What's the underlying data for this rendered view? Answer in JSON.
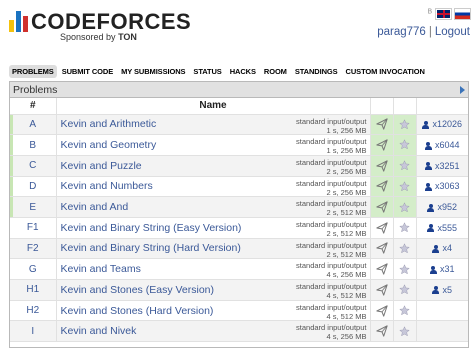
{
  "header": {
    "logo_text": "CODEFORCES",
    "sponsor_prefix": "Sponsored by",
    "sponsor_name": "TON",
    "username": "parag776",
    "separator": "|",
    "logout": "Logout"
  },
  "menu": [
    {
      "label": "PROBLEMS",
      "active": true
    },
    {
      "label": "SUBMIT CODE",
      "active": false
    },
    {
      "label": "MY SUBMISSIONS",
      "active": false
    },
    {
      "label": "STATUS",
      "active": false
    },
    {
      "label": "HACKS",
      "active": false
    },
    {
      "label": "ROOM",
      "active": false
    },
    {
      "label": "STANDINGS",
      "active": false
    },
    {
      "label": "CUSTOM INVOCATION",
      "active": false
    }
  ],
  "panel": {
    "title": "Problems",
    "col_index": "#",
    "col_name": "Name"
  },
  "problems": [
    {
      "index": "A",
      "name": "Kevin and Arithmetic",
      "io": "standard input/output",
      "limits": "1 s, 256 MB",
      "accepted": true,
      "solved": "x12026"
    },
    {
      "index": "B",
      "name": "Kevin and Geometry",
      "io": "standard input/output",
      "limits": "1 s, 256 MB",
      "accepted": true,
      "solved": "x6044"
    },
    {
      "index": "C",
      "name": "Kevin and Puzzle",
      "io": "standard input/output",
      "limits": "2 s, 256 MB",
      "accepted": true,
      "solved": "x3251"
    },
    {
      "index": "D",
      "name": "Kevin and Numbers",
      "io": "standard input/output",
      "limits": "2 s, 256 MB",
      "accepted": true,
      "solved": "x3063"
    },
    {
      "index": "E",
      "name": "Kevin and And",
      "io": "standard input/output",
      "limits": "2 s, 512 MB",
      "accepted": true,
      "solved": "x952"
    },
    {
      "index": "F1",
      "name": "Kevin and Binary String (Easy Version)",
      "io": "standard input/output",
      "limits": "2 s, 512 MB",
      "accepted": false,
      "solved": "x555"
    },
    {
      "index": "F2",
      "name": "Kevin and Binary String (Hard Version)",
      "io": "standard input/output",
      "limits": "2 s, 512 MB",
      "accepted": false,
      "solved": "x4"
    },
    {
      "index": "G",
      "name": "Kevin and Teams",
      "io": "standard input/output",
      "limits": "4 s, 256 MB",
      "accepted": false,
      "solved": "x31"
    },
    {
      "index": "H1",
      "name": "Kevin and Stones (Easy Version)",
      "io": "standard input/output",
      "limits": "4 s, 512 MB",
      "accepted": false,
      "solved": "x5"
    },
    {
      "index": "H2",
      "name": "Kevin and Stones (Hard Version)",
      "io": "standard input/output",
      "limits": "4 s, 512 MB",
      "accepted": false,
      "solved": ""
    },
    {
      "index": "I",
      "name": "Kevin and Nivek",
      "io": "standard input/output",
      "limits": "4 s, 256 MB",
      "accepted": false,
      "solved": ""
    }
  ],
  "colors": {
    "link": "#3b5998",
    "accepted_bg": "#d4edc9",
    "row_alt": "#f3f3f3"
  }
}
